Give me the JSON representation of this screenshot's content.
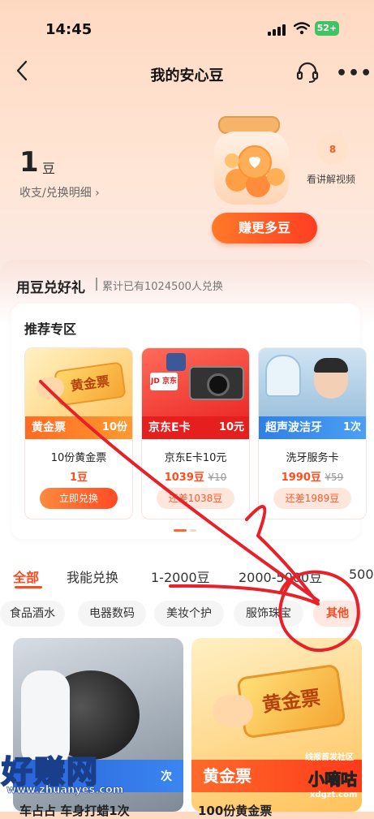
{
  "status_bar": {
    "time": "14:45",
    "battery": "52+"
  },
  "nav": {
    "title": "我的安心豆"
  },
  "balance": {
    "amount": "1",
    "unit": "豆",
    "detail_link": "收支/兑换明细 ›"
  },
  "promo": {
    "video_badge": "8",
    "video_label": "看讲解视频",
    "earn_button": "赚更多豆"
  },
  "section": {
    "title": "用豆兑好礼",
    "subtitle": "累计已有1024500人兑换"
  },
  "recommend": {
    "title": "推荐专区",
    "cards": [
      {
        "band": "黄金票",
        "count": "10份",
        "name": "10份黄金票",
        "price": "1豆",
        "old_price": "",
        "button": "立即兑换",
        "ticket": "黄金票"
      },
      {
        "band": "京东E卡",
        "count": "10元",
        "name": "京东E卡10元",
        "price": "1039豆",
        "old_price": "¥10",
        "button": "还差1038豆",
        "logo": "JD 京东"
      },
      {
        "band": "超声波洁牙",
        "count": "1次",
        "name": "洗牙服务卡",
        "price": "1990豆",
        "old_price": "¥59",
        "button": "还差1989豆"
      }
    ]
  },
  "tabs": [
    "全部",
    "我能兑换",
    "1-2000豆",
    "2000-5000豆",
    "500"
  ],
  "chips": [
    "食品酒水",
    "电器数码",
    "美妆个护",
    "服饰珠宝",
    "其他"
  ],
  "products": [
    {
      "count": "次",
      "name": "车占占 车身打蜡1次"
    },
    {
      "band": "黄金票",
      "name": "100份黄金票",
      "ticket": "黄金票"
    }
  ],
  "watermarks": {
    "brand1": "好赚网",
    "url1": "www.zhuanyes.com",
    "brand2_top": "线报首发社区",
    "brand2": "小嘀咕",
    "url2": "xdgzt.com"
  },
  "colors": {
    "accent": "#ff4a1f",
    "annotation": "#e8202a"
  }
}
